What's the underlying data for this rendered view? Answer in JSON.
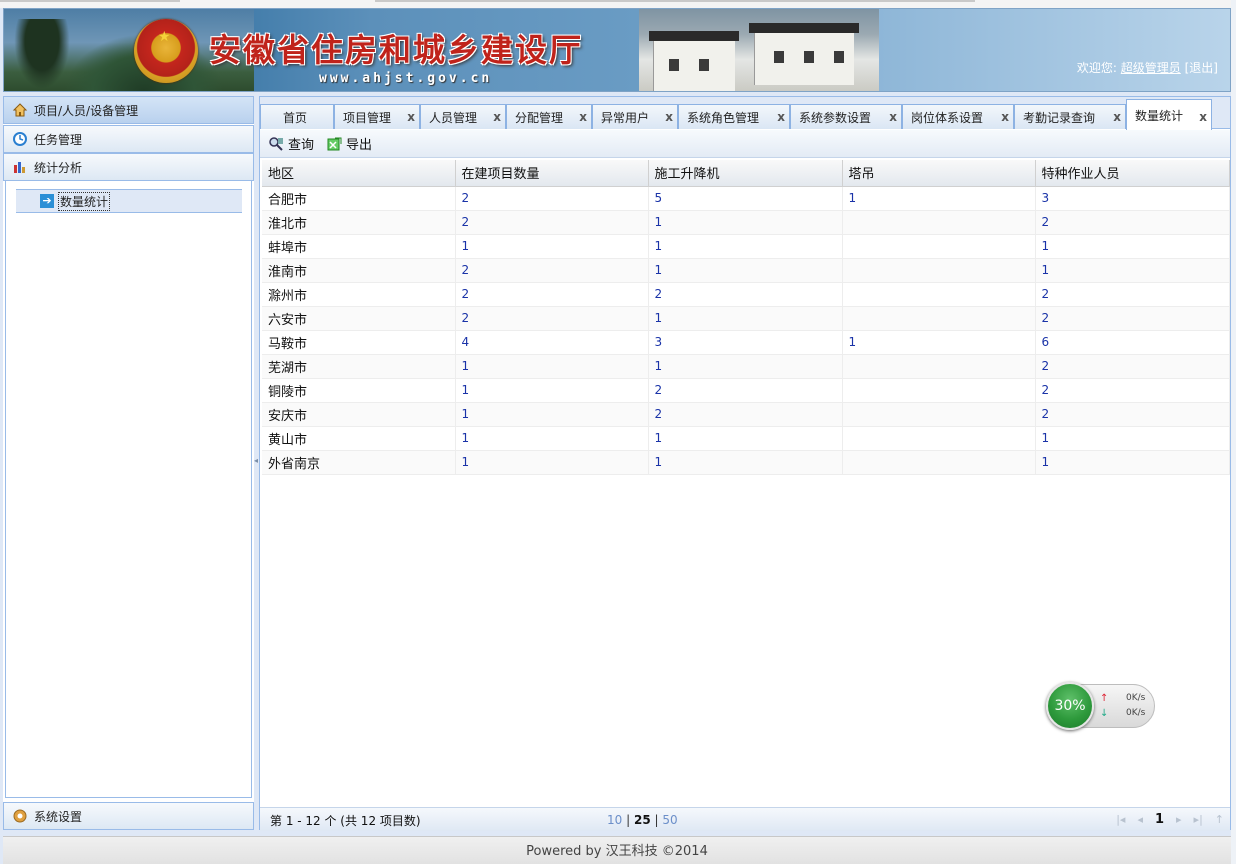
{
  "header": {
    "title": "安徽省住房和城乡建设厅",
    "url_text": "www.ahjst.gov.cn",
    "welcome_prefix": "欢迎您:",
    "username": "超级管理员",
    "logout": "[退出]"
  },
  "sidebar": {
    "sections": [
      {
        "label": "项目/人员/设备管理",
        "icon": "house-icon"
      },
      {
        "label": "任务管理",
        "icon": "clock-icon"
      },
      {
        "label": "统计分析",
        "icon": "chart-icon"
      }
    ],
    "tree_items": [
      {
        "label": "数量统计",
        "icon": "arrow-right-icon"
      }
    ],
    "bottom_section": {
      "label": "系统设置",
      "icon": "gear-icon"
    }
  },
  "tabs": [
    {
      "label": "首页",
      "closable": false
    },
    {
      "label": "项目管理",
      "closable": true
    },
    {
      "label": "人员管理",
      "closable": true
    },
    {
      "label": "分配管理",
      "closable": true
    },
    {
      "label": "异常用户",
      "closable": true
    },
    {
      "label": "系统角色管理",
      "closable": true
    },
    {
      "label": "系统参数设置",
      "closable": true
    },
    {
      "label": "岗位体系设置",
      "closable": true
    },
    {
      "label": "考勤记录查询",
      "closable": true
    },
    {
      "label": "数量统计",
      "closable": true,
      "active": true
    }
  ],
  "tab_close_glyph": "x",
  "toolbar": {
    "query_label": "查询",
    "export_label": "导出"
  },
  "grid": {
    "columns": [
      "地区",
      "在建项目数量",
      "施工升降机",
      "塔吊",
      "特种作业人员"
    ],
    "rows": [
      [
        "合肥市",
        "2",
        "5",
        "1",
        "3"
      ],
      [
        "淮北市",
        "2",
        "1",
        "",
        "2"
      ],
      [
        "蚌埠市",
        "1",
        "1",
        "",
        "1"
      ],
      [
        "淮南市",
        "2",
        "1",
        "",
        "1"
      ],
      [
        "滁州市",
        "2",
        "2",
        "",
        "2"
      ],
      [
        "六安市",
        "2",
        "1",
        "",
        "2"
      ],
      [
        "马鞍市",
        "4",
        "3",
        "1",
        "6"
      ],
      [
        "芜湖市",
        "1",
        "1",
        "",
        "2"
      ],
      [
        "铜陵市",
        "1",
        "2",
        "",
        "2"
      ],
      [
        "安庆市",
        "1",
        "2",
        "",
        "2"
      ],
      [
        "黄山市",
        "1",
        "1",
        "",
        "1"
      ],
      [
        "外省南京",
        "1",
        "1",
        "",
        "1"
      ]
    ]
  },
  "pager": {
    "info": "第 1 - 12 个 (共 12 项目数)",
    "page_sizes": [
      "10",
      "25",
      "50"
    ],
    "separator": "|",
    "current_page": "1"
  },
  "netmeter": {
    "percent": "30%",
    "up_speed": "0K/s",
    "down_speed": "0K/s"
  },
  "footer": {
    "text": "Powered by 汉王科技 ©2014"
  },
  "colors": {
    "accent": "#99bbe8",
    "number_text": "#1a33a8",
    "header_red": "#c0231b"
  }
}
